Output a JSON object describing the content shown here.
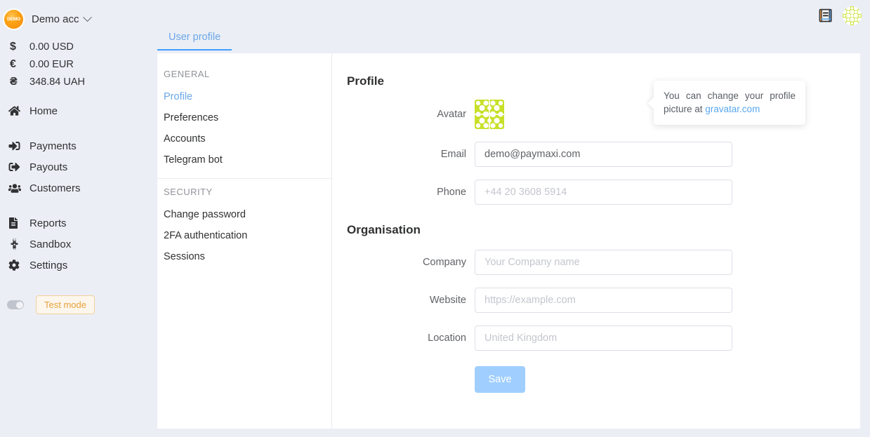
{
  "colors": {
    "page_bg": "#ebeef5",
    "panel_bg": "#ffffff",
    "accent_blue": "#409eff",
    "link_blue": "#5aa7f0",
    "muted_text": "#909399",
    "warning_orange": "#e6a23c",
    "save_button": "#a0cfff",
    "gravatar_green": "#c8e028"
  },
  "sidebar": {
    "account": {
      "badge_text": "DEMO",
      "name": "Demo acc",
      "chevron_icon": "chevron-down-icon"
    },
    "balances": [
      {
        "symbol": "$",
        "icon": "dollar-icon",
        "amount": "0.00 USD"
      },
      {
        "symbol": "€",
        "icon": "euro-icon",
        "amount": "0.00 EUR"
      },
      {
        "symbol": "₴",
        "icon": "hryvnia-icon",
        "amount": "348.84 UAH"
      }
    ],
    "nav_primary": [
      {
        "label": "Home",
        "icon": "home-icon"
      }
    ],
    "nav_secondary": [
      {
        "label": "Payments",
        "icon": "sign-in-arrow-icon"
      },
      {
        "label": "Payouts",
        "icon": "sign-out-arrow-icon"
      },
      {
        "label": "Customers",
        "icon": "users-group-icon"
      }
    ],
    "nav_tertiary": [
      {
        "label": "Reports",
        "icon": "document-icon"
      },
      {
        "label": "Sandbox",
        "icon": "code-brackets-icon"
      },
      {
        "label": "Settings",
        "icon": "gear-icon"
      }
    ],
    "test_mode": {
      "label": "Test mode",
      "toggle_icon": "toggle-switch-off-icon",
      "enabled": false
    }
  },
  "header": {
    "docs_icon": "book-icon",
    "avatar_icon": "user-gravatar-icon"
  },
  "tabs": [
    {
      "label": "User profile",
      "active": true
    }
  ],
  "settings_nav": {
    "groups": [
      {
        "title": "GENERAL",
        "items": [
          {
            "label": "Profile",
            "active": true
          },
          {
            "label": "Preferences",
            "active": false
          },
          {
            "label": "Accounts",
            "active": false
          },
          {
            "label": "Telegram bot",
            "active": false
          }
        ]
      },
      {
        "title": "SECURITY",
        "items": [
          {
            "label": "Change password",
            "active": false
          },
          {
            "label": "2FA authentication",
            "active": false
          },
          {
            "label": "Sessions",
            "active": false
          }
        ]
      }
    ]
  },
  "profile": {
    "section_title": "Profile",
    "avatar": {
      "label": "Avatar",
      "icon": "gravatar-identicon"
    },
    "tooltip": {
      "text_before": "You can change your profile picture at ",
      "link_text": "gravatar.com"
    },
    "fields": [
      {
        "label": "Email",
        "value": "demo@paymaxi.com",
        "placeholder": ""
      },
      {
        "label": "Phone",
        "value": "",
        "placeholder": "+44 20 3608 5914"
      }
    ]
  },
  "organisation": {
    "section_title": "Organisation",
    "fields": [
      {
        "label": "Company",
        "value": "",
        "placeholder": "Your Company name"
      },
      {
        "label": "Website",
        "value": "",
        "placeholder": "https://example.com"
      },
      {
        "label": "Location",
        "value": "",
        "placeholder": "United Kingdom"
      }
    ],
    "save_label": "Save"
  }
}
